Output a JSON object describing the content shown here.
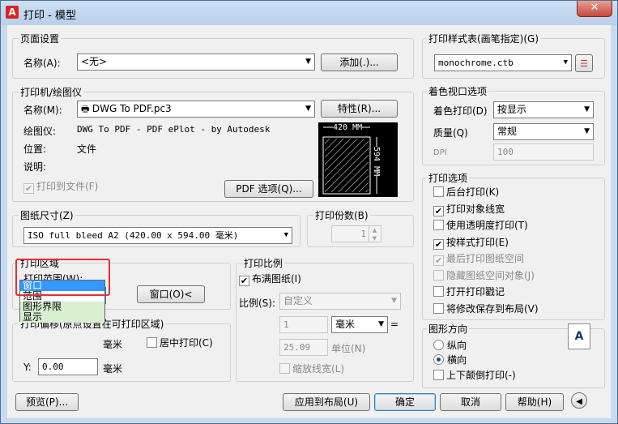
{
  "window": {
    "title": "打印 - 模型",
    "close_label": "✕",
    "app_icon_letter": "A"
  },
  "page_setup": {
    "group_title": "页面设置",
    "name_label": "名称(A):",
    "name_value": "<无>",
    "add_button": "添加(.)..."
  },
  "printer": {
    "group_title": "打印机/绘图仪",
    "name_label": "名称(M):",
    "name_value": "DWG To PDF.pc3",
    "properties_button": "特性(R)...",
    "plotter_label": "绘图仪:",
    "plotter_value": "DWG To PDF - PDF ePlot - by Autodesk",
    "location_label": "位置:",
    "location_value": "文件",
    "description_label": "说明:",
    "print_to_file": "打印到文件(F)",
    "print_to_file_checked": true,
    "pdf_options_button": "PDF 选项(Q)...",
    "preview_width_label": "420 MM",
    "preview_height_label": "594 MM"
  },
  "paper_size": {
    "group_title": "图纸尺寸(Z)",
    "value": "ISO full bleed A2 (420.00 x 594.00 毫米)"
  },
  "copies": {
    "group_title": "打印份数(B)",
    "value": "1"
  },
  "plot_area": {
    "group_title": "打印区域",
    "range_label": "打印范围(W):",
    "range_value": "窗口",
    "window_button": "窗口(O)<",
    "dropdown_options": [
      "窗口",
      "范围",
      "图形界限",
      "显示"
    ]
  },
  "plot_offset": {
    "group_title": "打印偏移(原点设置在可打印区域)",
    "x_unit": "毫米",
    "center_plot": "居中打印(C)",
    "center_plot_checked": false,
    "y_label": "Y:",
    "y_value": "0.00",
    "y_unit": "毫米"
  },
  "plot_scale": {
    "group_title": "打印比例",
    "fit_to_paper": "布满图纸(I)",
    "fit_to_paper_checked": true,
    "scale_label": "比例(S):",
    "scale_value": "自定义",
    "value1": "1",
    "unit_value": "毫米",
    "equals": "=",
    "value2": "25.09",
    "unit_label": "单位(N)",
    "scale_lineweights": "缩放线宽(L)",
    "scale_lineweights_checked": false
  },
  "plot_style_table": {
    "group_title": "打印样式表(画笔指定)(G)",
    "value": "monochrome.ctb"
  },
  "shaded_viewport": {
    "group_title": "着色视口选项",
    "shade_plot_label": "着色打印(D)",
    "shade_plot_value": "按显示",
    "quality_label": "质量(Q)",
    "quality_value": "常规",
    "dpi_label": "DPI",
    "dpi_value": "100"
  },
  "plot_options": {
    "group_title": "打印选项",
    "items": [
      {
        "label": "后台打印(K)",
        "mark": "",
        "disabled": false
      },
      {
        "label": "打印对象线宽",
        "mark": "✔",
        "disabled": false
      },
      {
        "label": "使用透明度打印(T)",
        "mark": "",
        "disabled": false
      },
      {
        "label": "按样式打印(E)",
        "mark": "✔",
        "disabled": false
      },
      {
        "label": "最后打印图纸空间",
        "mark": "✔",
        "disabled": true
      },
      {
        "label": "隐藏图纸空间对象(J)",
        "mark": "",
        "disabled": true
      },
      {
        "label": "打开打印戳记",
        "mark": "",
        "disabled": false
      },
      {
        "label": "将修改保存到布局(V)",
        "mark": "",
        "disabled": false
      }
    ]
  },
  "orientation": {
    "group_title": "图形方向",
    "portrait": "纵向",
    "landscape": "横向",
    "selected": "landscape",
    "upside_down": "上下颠倒打印(-)",
    "upside_down_checked": false,
    "icon_letter": "A"
  },
  "footer": {
    "preview_button": "预览(P)...",
    "apply_layout_button": "应用到布局(U)",
    "ok_button": "确定",
    "cancel_button": "取消",
    "help_button": "帮助(H)",
    "expand_icon": "◀"
  },
  "colors": {
    "highlight": "#3399ff",
    "callout": "#e53030"
  }
}
